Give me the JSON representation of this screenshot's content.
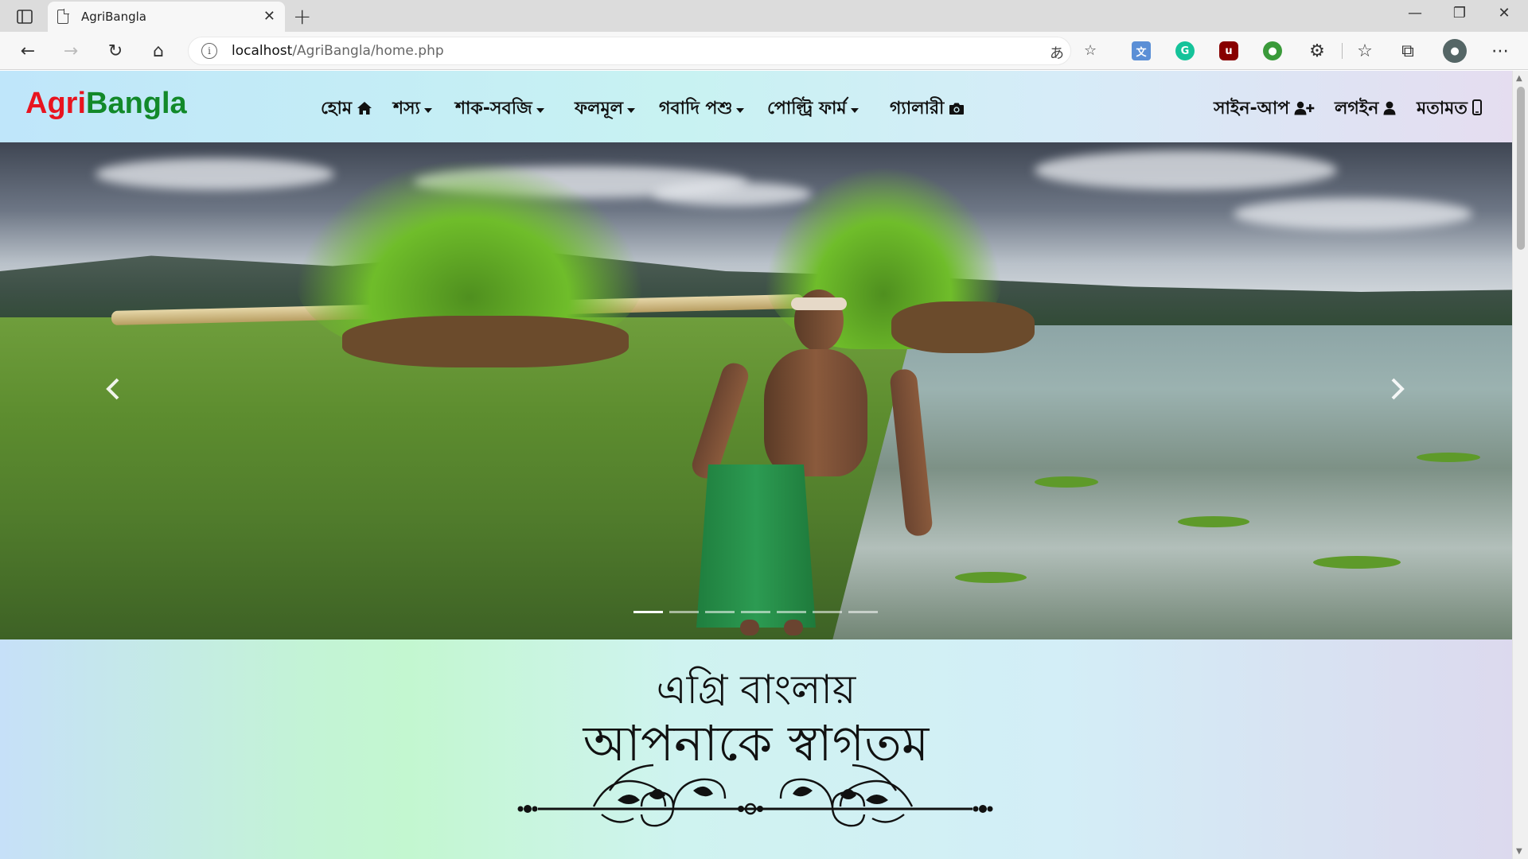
{
  "browser": {
    "tab_title": "AgriBangla",
    "address_host": "localhost",
    "address_path": "/AgriBangla/home.php"
  },
  "site": {
    "brand_part1": "Agri",
    "brand_part2": "Bangla",
    "nav": [
      {
        "label": "হোম",
        "icon": "home-icon"
      },
      {
        "label": "শস্য",
        "icon": "caret-down-icon"
      },
      {
        "label": "শাক-সবজি",
        "icon": "caret-down-icon"
      },
      {
        "label": "ফলমূল",
        "icon": "caret-down-icon"
      },
      {
        "label": "গবাদি পশু",
        "icon": "caret-down-icon"
      },
      {
        "label": "পোল্ট্রি ফার্ম",
        "icon": "caret-down-icon"
      },
      {
        "label": "গ্যালারী",
        "icon": "camera-icon"
      }
    ],
    "nav_right": [
      {
        "label": "সাইন-আপ",
        "icon": "user-plus-icon"
      },
      {
        "label": "লগইন",
        "icon": "user-icon"
      },
      {
        "label": "মতামত",
        "icon": "mobile-icon"
      }
    ],
    "carousel": {
      "slide_count": 7,
      "active_index": 0
    },
    "welcome": {
      "line1": "এগ্রি বাংলায়",
      "line2": "আপনাকে স্বাগতম"
    }
  }
}
